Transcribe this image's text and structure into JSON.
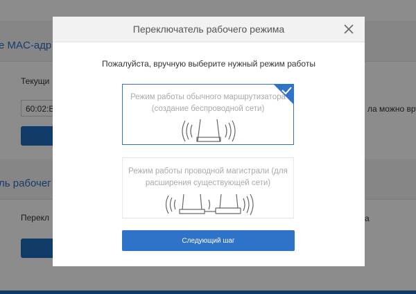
{
  "background": {
    "mac_heading": "е MAC-адр",
    "current_label": "Текущи",
    "mac_value": "60:02:B",
    "right_text_1": "ла можно вру",
    "mode_heading": "ль рабочег",
    "switch_label": "Перекл",
    "right_text_2": "а"
  },
  "modal": {
    "title": "Переключатель рабочего режима",
    "prompt": "Пожалуйста, вручную выберите нужный режим работы",
    "modes": [
      {
        "label": "Режим работы обычного маршрутизатора (создание беспроводной сети)",
        "selected": true
      },
      {
        "label": "Режим работы проводной магистрали (для расширения существующей сети)",
        "selected": false
      }
    ],
    "next_label": "Следующий шаг"
  },
  "colors": {
    "accent": "#2f73c8",
    "overlay": "rgba(0,0,0,0.45)"
  }
}
